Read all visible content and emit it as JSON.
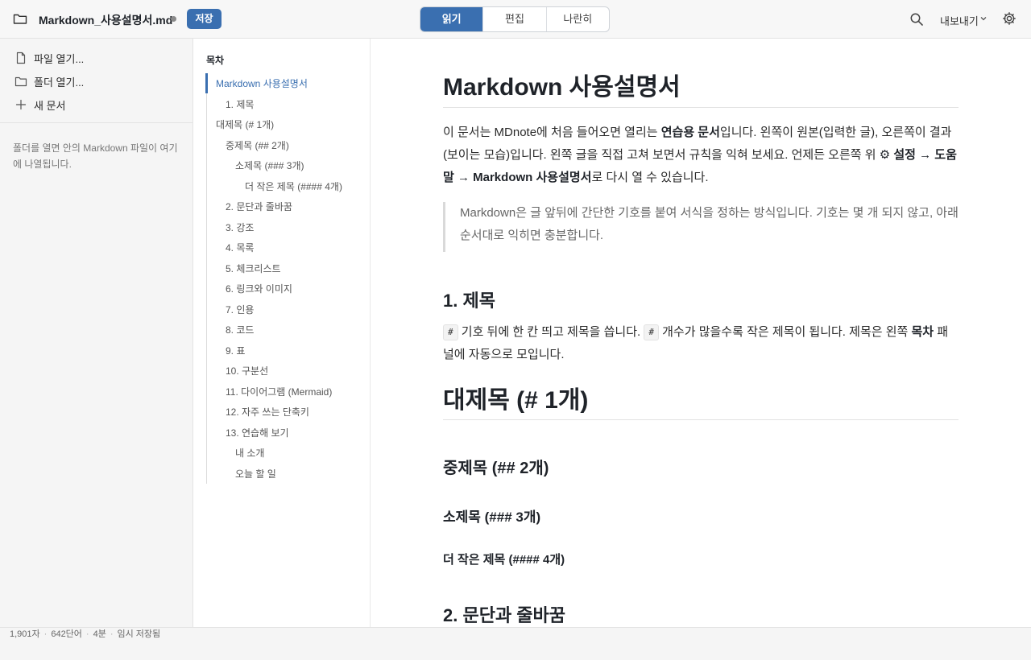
{
  "topbar": {
    "filename": "Markdown_사용설명서.md",
    "save_label": "저장",
    "modes": [
      "읽기",
      "편집",
      "나란히"
    ],
    "active_mode": "읽기",
    "export_label": "내보내기",
    "icons": [
      "folder-icon",
      "search-icon",
      "chevron-down-icon",
      "gear-icon"
    ]
  },
  "sidebar": {
    "items": [
      {
        "label": "파일 열기...",
        "icon": "file-icon"
      },
      {
        "label": "폴더 열기...",
        "icon": "folder-icon"
      },
      {
        "label": "새 문서",
        "icon": "plus-icon"
      }
    ],
    "hint": "폴더를 열면 안의 Markdown 파일이 여기에 나열됩니다."
  },
  "toc": {
    "title": "목차",
    "items": [
      {
        "label": "Markdown 사용설명서",
        "level": 0,
        "active": true
      },
      {
        "label": "1. 제목",
        "level": 1
      },
      {
        "label": "대제목 (# 1개)",
        "level": 0
      },
      {
        "label": "중제목 (## 2개)",
        "level": 1
      },
      {
        "label": "소제목 (### 3개)",
        "level": 2
      },
      {
        "label": "더 작은 제목 (#### 4개)",
        "level": 3
      },
      {
        "label": "2. 문단과 줄바꿈",
        "level": 1
      },
      {
        "label": "3. 강조",
        "level": 1
      },
      {
        "label": "4. 목록",
        "level": 1
      },
      {
        "label": "5. 체크리스트",
        "level": 1
      },
      {
        "label": "6. 링크와 이미지",
        "level": 1
      },
      {
        "label": "7. 인용",
        "level": 1
      },
      {
        "label": "8. 코드",
        "level": 1
      },
      {
        "label": "9. 표",
        "level": 1
      },
      {
        "label": "10. 구분선",
        "level": 1
      },
      {
        "label": "11. 다이어그램 (Mermaid)",
        "level": 1
      },
      {
        "label": "12. 자주 쓰는 단축키",
        "level": 1
      },
      {
        "label": "13. 연습해 보기",
        "level": 1
      },
      {
        "label": "내 소개",
        "level": 2
      },
      {
        "label": "오늘 할 일",
        "level": 2
      }
    ]
  },
  "content": {
    "title": "Markdown 사용설명서",
    "intro": {
      "p1": "이 문서는 MDnote에 처음 들어오면 열리는 ",
      "b1": "연습용 문서",
      "p2": "입니다. 왼쪽이 원본(입력한 글), 오른쪽이 결과(보이는 모습)입니다. 왼쪽 글을 직접 고쳐 보면서 규칙을 익혀 보세요. 언제든 오른쪽 위 ",
      "b2": "⚙ 설정 → 도움말 → Markdown 사용설명서",
      "p3": "로 다시 열 수 있습니다."
    },
    "quote": "Markdown은 글 앞뒤에 간단한 기호를 붙여 서식을 정하는 방식입니다. 기호는 몇 개 되지 않고, 아래 순서대로 익히면 충분합니다.",
    "section1": {
      "title": "1. 제목",
      "code": "#",
      "t1": " 기호 뒤에 한 칸 띄고 제목을 씁니다. ",
      "t2": " 개수가 많을수록 작은 제목이 됩니다. 제목은 왼쪽 ",
      "b": "목차",
      "t3": " 패널에 자동으로 모입니다."
    },
    "h1_demo": "대제목 (# 1개)",
    "h2_demo": "중제목 (## 2개)",
    "h3_demo": "소제목 (### 3개)",
    "h4_demo": "더 작은 제목 (#### 4개)",
    "section2_title": "2. 문단과 줄바꿈"
  },
  "status": {
    "chars": "1,901자",
    "words": "642단어",
    "minutes": "4분",
    "save_state": "임시 저장됨"
  }
}
